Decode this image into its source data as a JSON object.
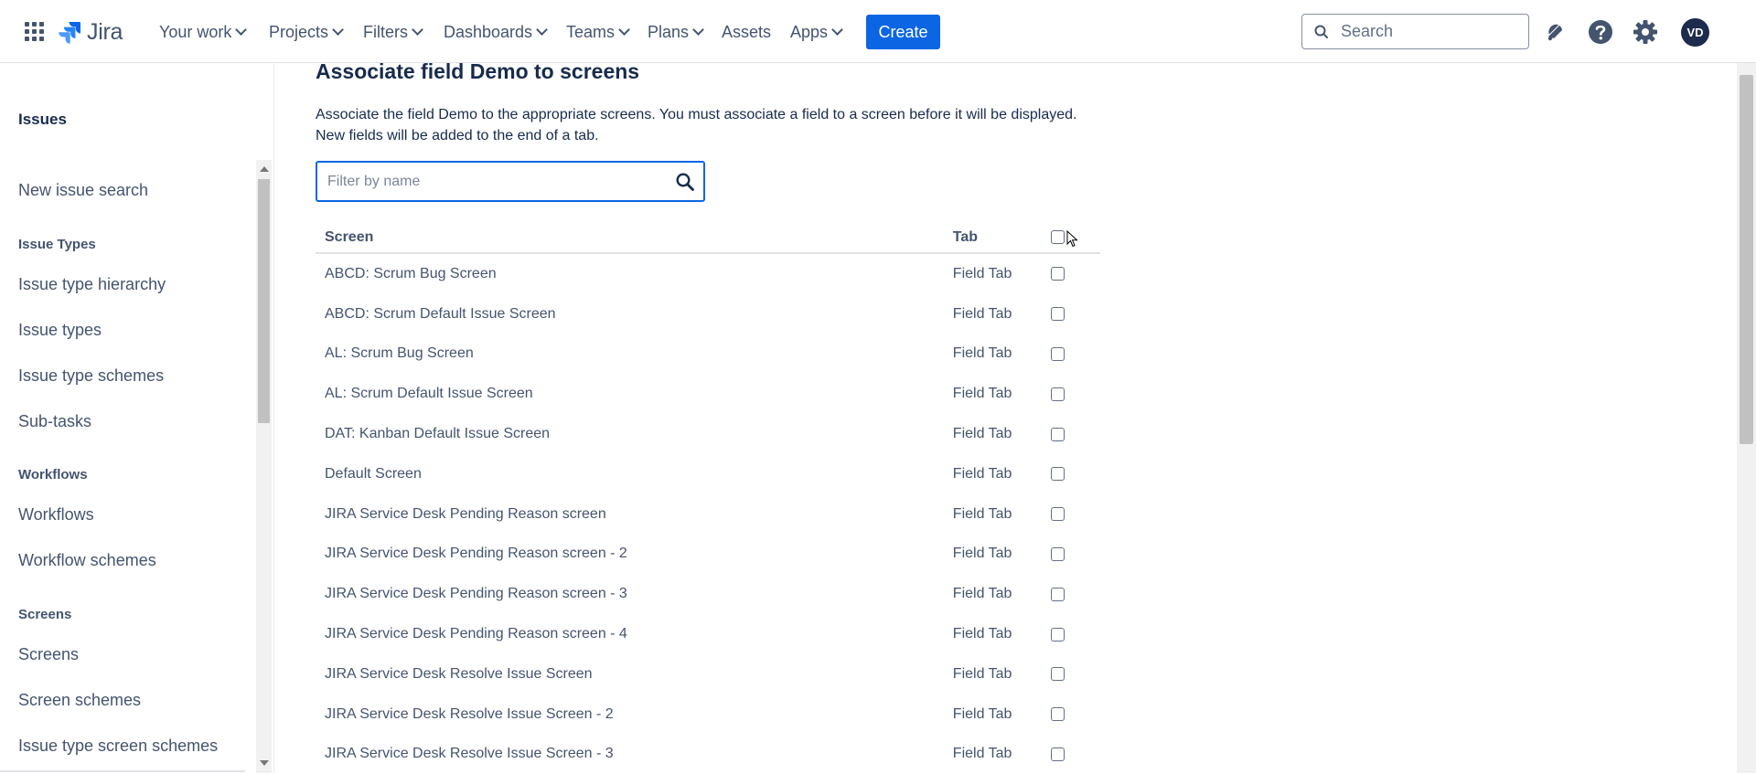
{
  "nav": {
    "logo_text": "Jira",
    "items": [
      {
        "label": "Your work",
        "dropdown": true
      },
      {
        "label": "Projects",
        "dropdown": true
      },
      {
        "label": "Filters",
        "dropdown": true
      },
      {
        "label": "Dashboards",
        "dropdown": true
      },
      {
        "label": "Teams",
        "dropdown": true
      },
      {
        "label": "Plans",
        "dropdown": true
      },
      {
        "label": "Assets",
        "dropdown": false
      },
      {
        "label": "Apps",
        "dropdown": true
      }
    ],
    "create_label": "Create",
    "search_placeholder": "Search",
    "avatar_initials": "VD",
    "icons": [
      "app-switcher-icon",
      "notifications-icon",
      "help-icon",
      "settings-icon"
    ]
  },
  "sidebar": {
    "title": "Issues",
    "entries": [
      {
        "type": "link",
        "label": "New issue search"
      },
      {
        "type": "heading",
        "label": "Issue Types"
      },
      {
        "type": "link",
        "label": "Issue type hierarchy"
      },
      {
        "type": "link",
        "label": "Issue types"
      },
      {
        "type": "link",
        "label": "Issue type schemes"
      },
      {
        "type": "link",
        "label": "Sub-tasks"
      },
      {
        "type": "heading",
        "label": "Workflows"
      },
      {
        "type": "link",
        "label": "Workflows"
      },
      {
        "type": "link",
        "label": "Workflow schemes"
      },
      {
        "type": "heading",
        "label": "Screens"
      },
      {
        "type": "link",
        "label": "Screens"
      },
      {
        "type": "link",
        "label": "Screen schemes"
      },
      {
        "type": "link",
        "label": "Issue type screen schemes"
      }
    ]
  },
  "main": {
    "title": "Associate field Demo to screens",
    "description": "Associate the field Demo to the appropriate screens. You must associate a field to a screen before it will be displayed. New fields will be added to the end of a tab.",
    "filter_placeholder": "Filter by name",
    "table": {
      "headers": {
        "screen": "Screen",
        "tab": "Tab"
      },
      "rows": [
        {
          "screen": "ABCD: Scrum Bug Screen",
          "tab": "Field Tab",
          "checked": false
        },
        {
          "screen": "ABCD: Scrum Default Issue Screen",
          "tab": "Field Tab",
          "checked": false
        },
        {
          "screen": "AL: Scrum Bug Screen",
          "tab": "Field Tab",
          "checked": false
        },
        {
          "screen": "AL: Scrum Default Issue Screen",
          "tab": "Field Tab",
          "checked": false
        },
        {
          "screen": "DAT: Kanban Default Issue Screen",
          "tab": "Field Tab",
          "checked": false
        },
        {
          "screen": "Default Screen",
          "tab": "Field Tab",
          "checked": false
        },
        {
          "screen": "JIRA Service Desk Pending Reason screen",
          "tab": "Field Tab",
          "checked": false
        },
        {
          "screen": "JIRA Service Desk Pending Reason screen - 2",
          "tab": "Field Tab",
          "checked": false
        },
        {
          "screen": "JIRA Service Desk Pending Reason screen - 3",
          "tab": "Field Tab",
          "checked": false
        },
        {
          "screen": "JIRA Service Desk Pending Reason screen - 4",
          "tab": "Field Tab",
          "checked": false
        },
        {
          "screen": "JIRA Service Desk Resolve Issue Screen",
          "tab": "Field Tab",
          "checked": false
        },
        {
          "screen": "JIRA Service Desk Resolve Issue Screen - 2",
          "tab": "Field Tab",
          "checked": false
        },
        {
          "screen": "JIRA Service Desk Resolve Issue Screen - 3",
          "tab": "Field Tab",
          "checked": false
        }
      ]
    }
  },
  "colors": {
    "brand": "#0c66e4",
    "text": "#172b4d",
    "subtle": "#44546f"
  }
}
